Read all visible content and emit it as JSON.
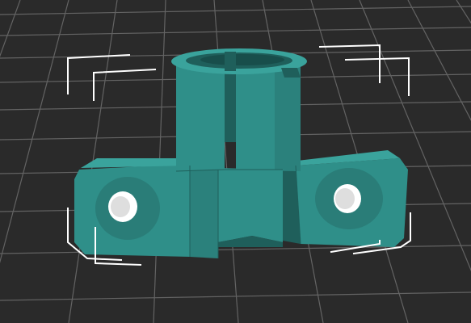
{
  "viewport": {
    "background": "#2a2a2a",
    "grid_color": "#6a6a6a",
    "part_color": "#2f8f89",
    "part_shadow_color": "#1f5f5b",
    "part_highlight_color": "#3aa39c",
    "selection_box_color": "#ffffff"
  },
  "model": {
    "icon": "3d-part-bracket-icon",
    "selected": true
  }
}
